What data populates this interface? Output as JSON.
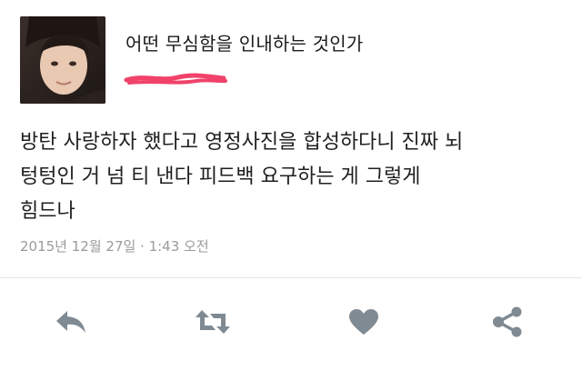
{
  "user": {
    "display_name": "어떤 무심함을 인내하는 것인가",
    "handle_redacted": true
  },
  "tweet": {
    "text_lines": [
      "방탄 사랑하자 했다고 영정사진을 합성하다니 진짜 뇌",
      "텅텅인 거 넘 티 낸다 피드백 요구하는 게 그렇게",
      "힘드나"
    ],
    "timestamp": "2015년 12월 27일 · 1:43 오전"
  },
  "actions": [
    {
      "name": "reply",
      "icon": "reply-icon"
    },
    {
      "name": "retweet",
      "icon": "retweet-icon"
    },
    {
      "name": "like",
      "icon": "heart-icon"
    },
    {
      "name": "share",
      "icon": "share-icon"
    }
  ],
  "colors": {
    "icon_gray": "#7f8a93",
    "timestamp_gray": "#9a9a9a",
    "redaction_red": "#f0426a"
  }
}
